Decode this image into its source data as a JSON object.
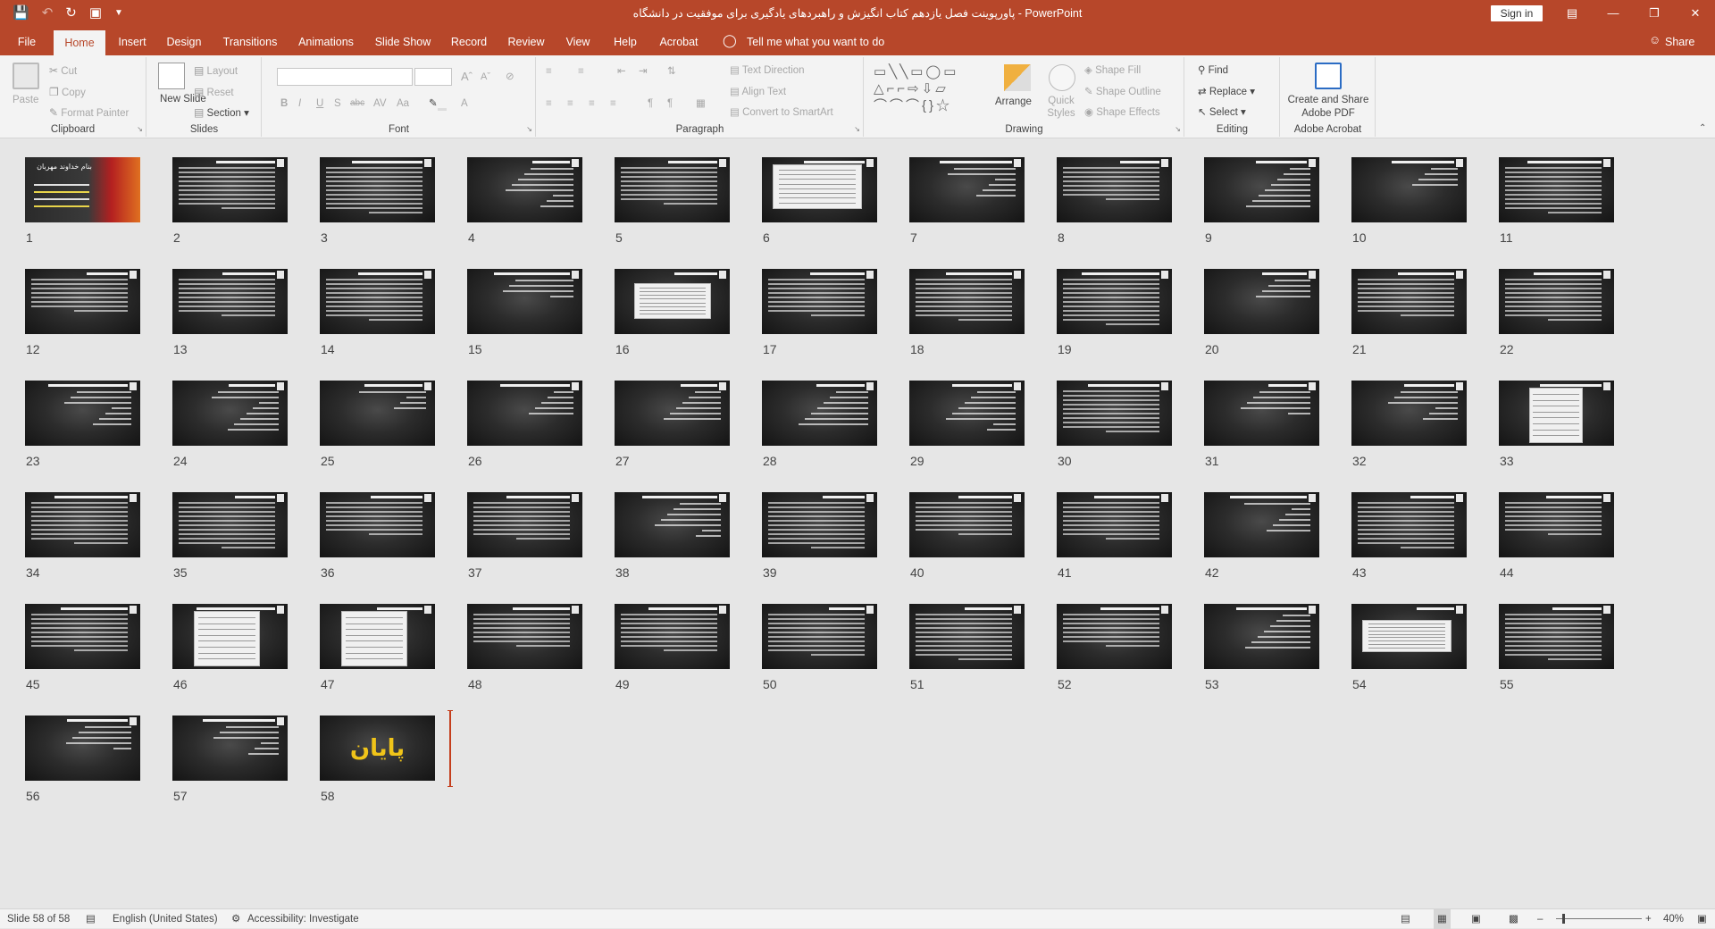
{
  "app": {
    "doc_title": "پاورپوینت فصل یازدهم کتاب انگیزش و راهبردهای یادگیری برای موفقیت در دانشگاه - PowerPoint",
    "sign_in": "Sign in"
  },
  "tabs": [
    "File",
    "Home",
    "Insert",
    "Design",
    "Transitions",
    "Animations",
    "Slide Show",
    "Record",
    "Review",
    "View",
    "Help",
    "Acrobat"
  ],
  "tell_me": "Tell me what you want to do",
  "share": "Share",
  "ribbon": {
    "clipboard": {
      "label": "Clipboard",
      "paste": "Paste",
      "cut": "Cut",
      "copy": "Copy",
      "format_painter": "Format Painter"
    },
    "slides": {
      "label": "Slides",
      "new_slide": "New Slide",
      "layout": "Layout",
      "reset": "Reset",
      "section": "Section"
    },
    "font": {
      "label": "Font"
    },
    "paragraph": {
      "label": "Paragraph",
      "text_direction": "Text Direction",
      "align_text": "Align Text",
      "convert_smartart": "Convert to SmartArt"
    },
    "drawing": {
      "label": "Drawing",
      "arrange": "Arrange",
      "quick_styles": "Quick Styles",
      "shape_fill": "Shape Fill",
      "shape_outline": "Shape Outline",
      "shape_effects": "Shape Effects"
    },
    "editing": {
      "label": "Editing",
      "find": "Find",
      "replace": "Replace",
      "select": "Select"
    },
    "acrobat": {
      "label": "Adobe Acrobat",
      "create_share": "Create and Share Adobe PDF"
    }
  },
  "slides": {
    "count": 58,
    "last_slide_text": "پایان",
    "first_slide_title": "بنام خداوند مهربان"
  },
  "status": {
    "slide_of": "Slide 58 of 58",
    "language": "English (United States)",
    "accessibility": "Accessibility: Investigate",
    "zoom": "40%"
  }
}
